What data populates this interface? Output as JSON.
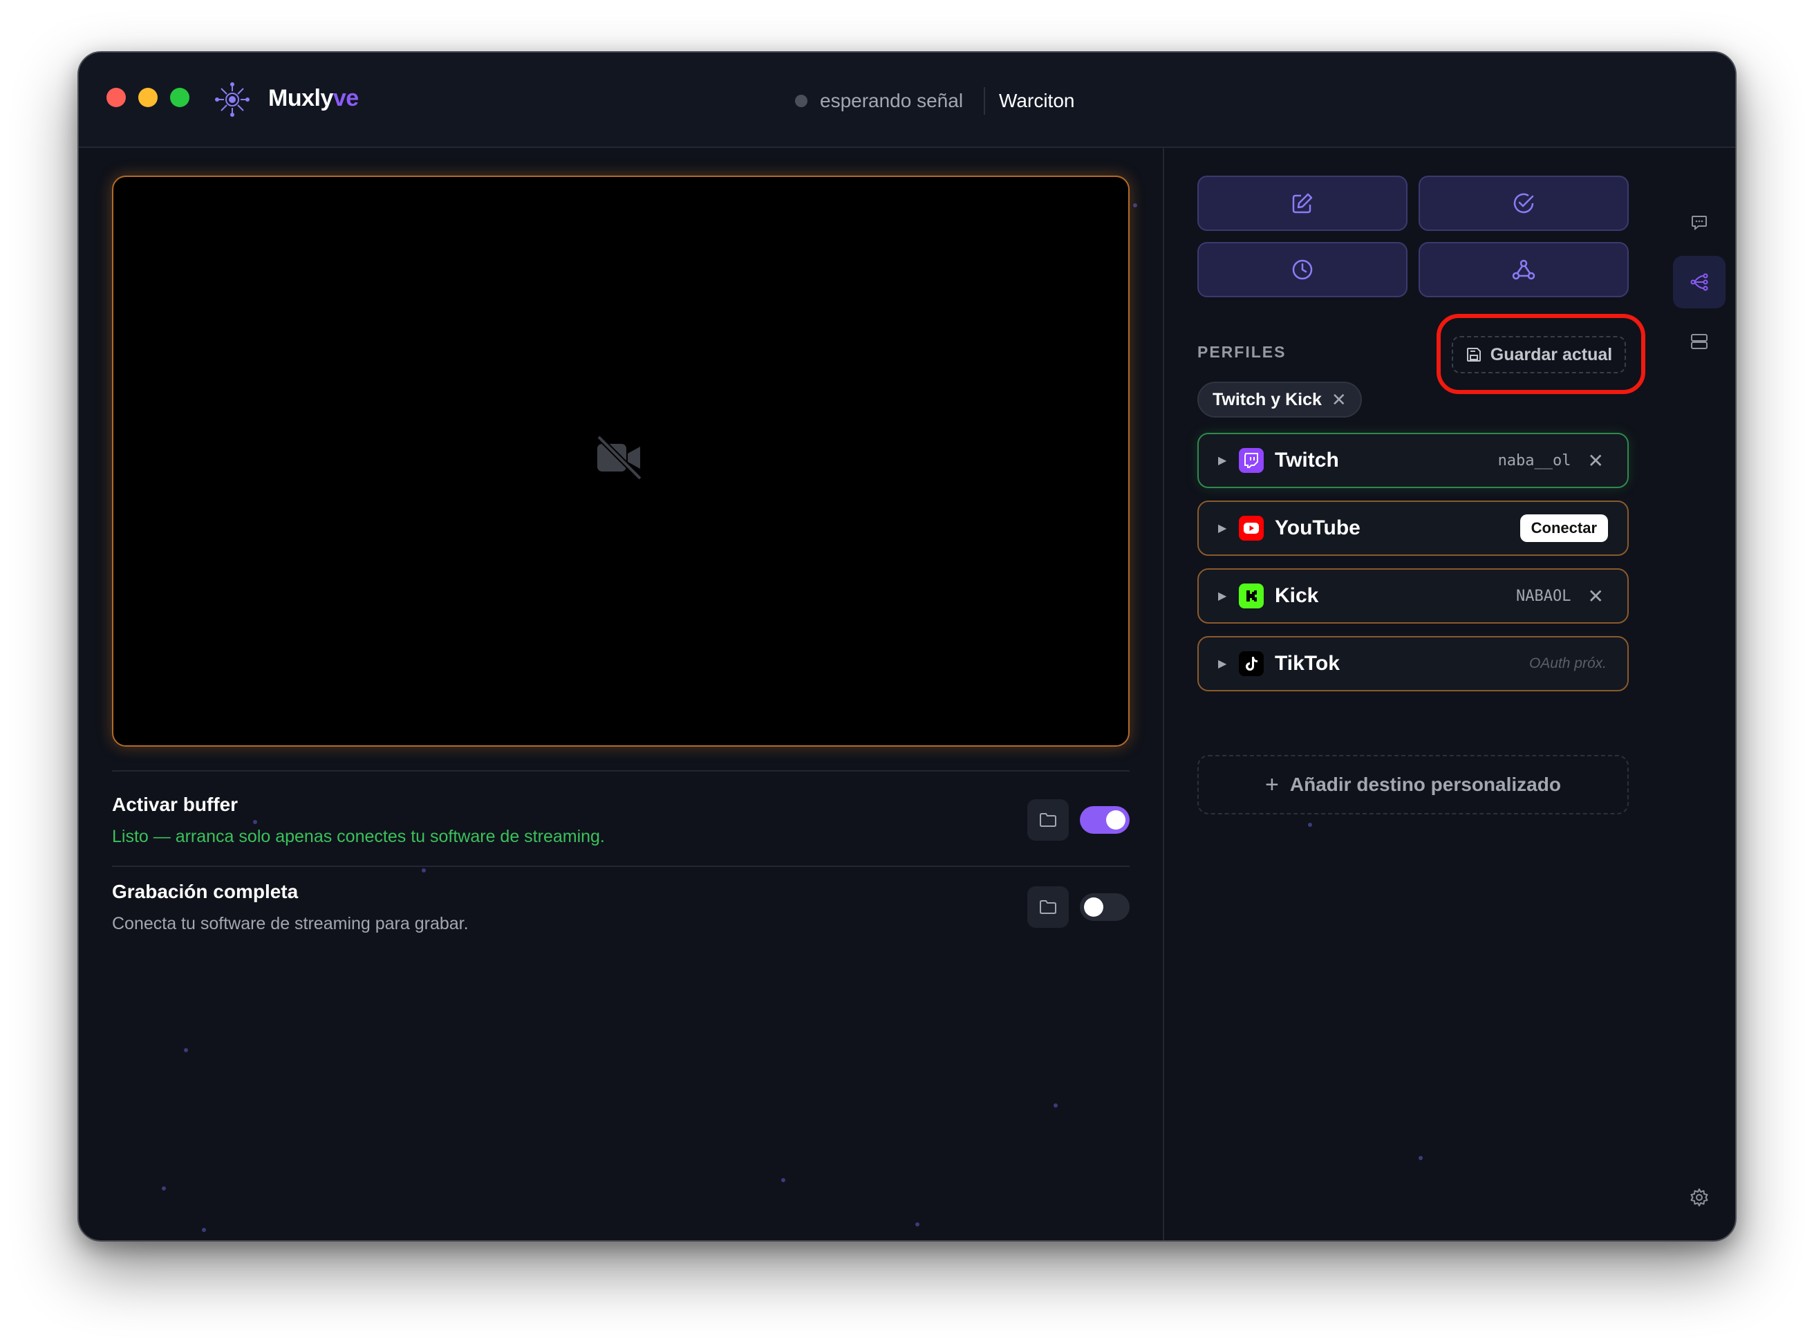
{
  "app": {
    "title_main": "Muxly",
    "title_accent": "ve",
    "status_text": "esperando señal",
    "profile_name": "Warciton"
  },
  "preview": {
    "icon": "video-off-icon"
  },
  "options": [
    {
      "title": "Activar buffer",
      "description": "Listo — arranca solo apenas conectes tu software de streaming.",
      "enabled": true
    },
    {
      "title": "Grabación completa",
      "description": "Conecta tu software de streaming para grabar.",
      "enabled": false
    }
  ],
  "quick_actions": [
    "edit-icon",
    "check-circle-icon",
    "clock-icon",
    "webhook-icon"
  ],
  "profiles": {
    "label": "PERFILES",
    "save_label": "Guardar actual",
    "chips": [
      "Twitch y Kick"
    ]
  },
  "destinations": [
    {
      "name": "Twitch",
      "account": "naba__ol",
      "state": "connected",
      "color": "#9146ff"
    },
    {
      "name": "YouTube",
      "action": "Conectar",
      "state": "disconnected",
      "color": "#ff0000"
    },
    {
      "name": "Kick",
      "account": "NABAOL",
      "state": "connected",
      "color": "#53fc18"
    },
    {
      "name": "TikTok",
      "note": "OAuth próx.",
      "state": "unavailable",
      "color": "#000000"
    }
  ],
  "add_destination_label": "Añadir destino personalizado",
  "colors": {
    "accent": "#8b5cf6",
    "success": "#3bc15c",
    "highlight": "#f2190f"
  }
}
